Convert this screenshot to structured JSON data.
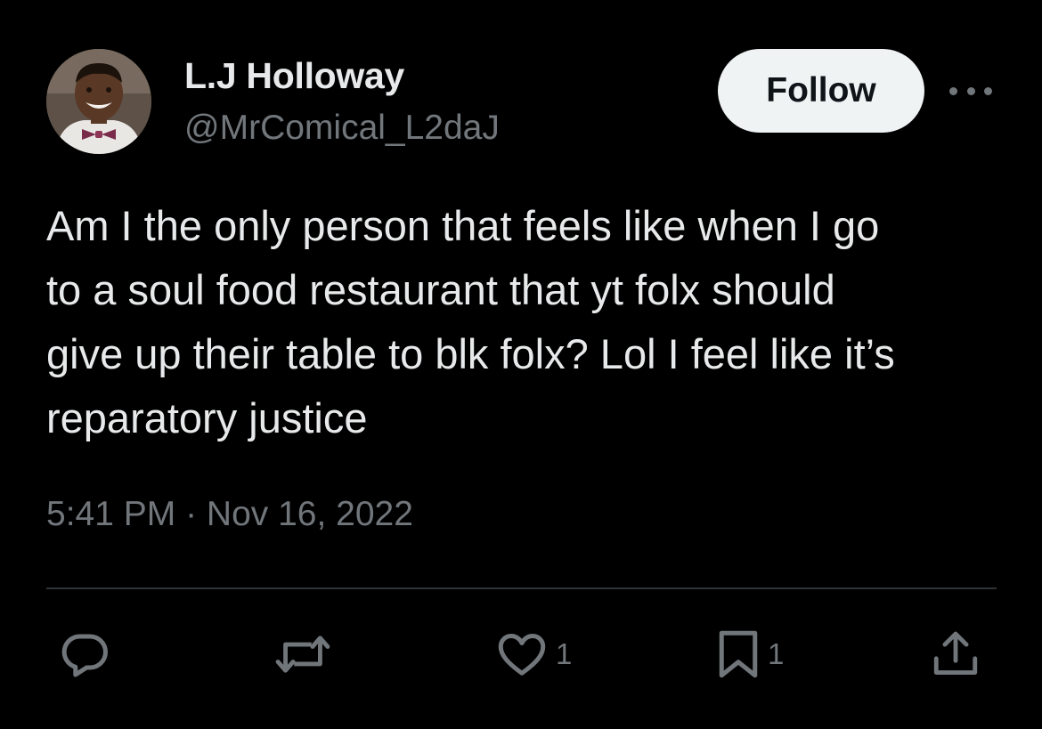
{
  "tweet": {
    "author": {
      "display_name": "L.J Holloway",
      "handle": "@MrComical_L2daJ"
    },
    "follow_label": "Follow",
    "text": "Am I the only person that feels like when I go\nto a soul food restaurant that yt folx should\ngive up their table to blk folx? Lol I feel like it’s\nreparatory justice",
    "timestamp": "5:41 PM · Nov 16, 2022",
    "actions": {
      "reply": {
        "icon": "reply-icon"
      },
      "retweet": {
        "icon": "retweet-icon"
      },
      "like": {
        "icon": "heart-icon",
        "count": "1"
      },
      "bookmark": {
        "icon": "bookmark-icon",
        "count": "1"
      },
      "share": {
        "icon": "share-icon"
      }
    }
  },
  "colors": {
    "background": "#000000",
    "primary_text": "#e7e9ea",
    "secondary_text": "#71767b",
    "divider": "#2f3336",
    "follow_button_bg": "#eff3f4"
  }
}
